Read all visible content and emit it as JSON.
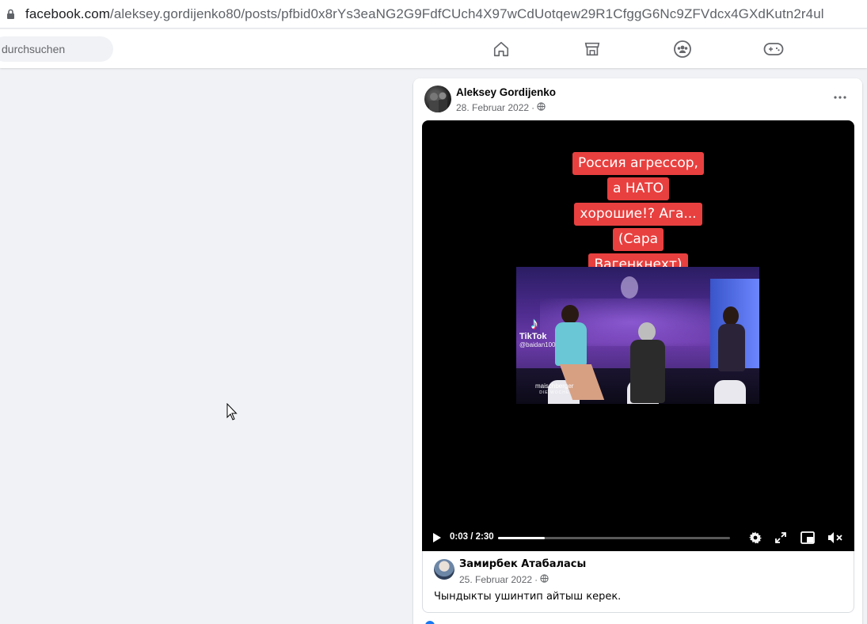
{
  "browser": {
    "url_domain": "facebook.com",
    "url_path": "/aleksey.gordijenko80/posts/pfbid0x8rYs3eaNG2G9FdfCUch4X97wCdUotqew29R1CfggG6Nc9ZFVdcx4GXdKutn2r4ul"
  },
  "topbar": {
    "search_placeholder": "durchsuchen",
    "nav_icons": [
      "home-icon",
      "marketplace-icon",
      "groups-icon",
      "gaming-icon"
    ]
  },
  "post": {
    "author": "Aleksey Gordijenko",
    "date": "28. Februar 2022",
    "separator": "·",
    "privacy_icon": "globe-icon",
    "video": {
      "caption_lines": [
        "Россия агрессор,",
        "а НАТО",
        "хорошие!? Ага...",
        "(Сара",
        "Вагенкнехт)"
      ],
      "watermark_brand": "TikTok",
      "watermark_handle": "@baidan100",
      "show_logo": "maischberger",
      "show_logo_sub": "DIE WOCHE",
      "time": "0:03 / 2:30",
      "progress": 0.2
    },
    "shared": {
      "author": "Замирбек Атабаласы",
      "date": "25. Februar 2022",
      "separator": "·",
      "text": "Чындыкты ушинтип айтыш керек."
    }
  },
  "colors": {
    "caption_bg": "#e8403f",
    "page_bg": "#f0f2f5",
    "accent": "#1877f2"
  }
}
